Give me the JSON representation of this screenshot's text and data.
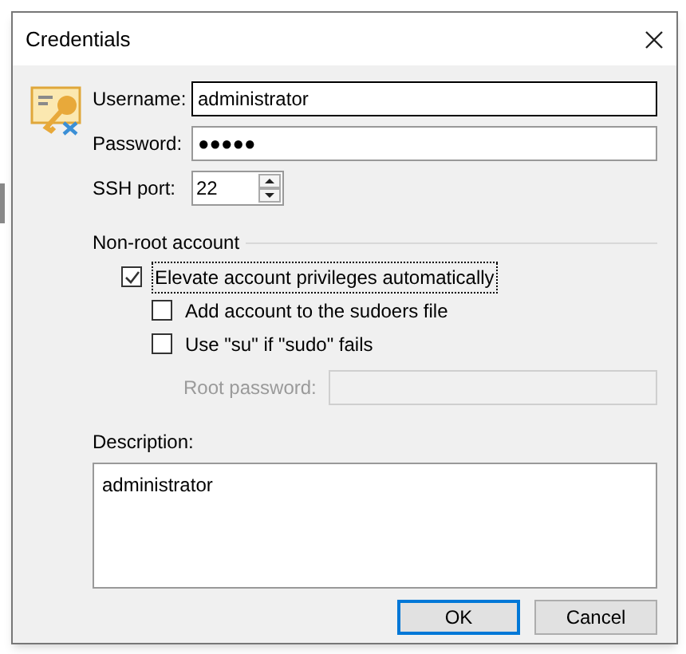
{
  "window": {
    "title": "Credentials"
  },
  "fields": [
    {
      "label": "Username:",
      "value": "administrator",
      "kind": "text",
      "focused": true
    },
    {
      "label": "Password:",
      "value": "●●●●●",
      "kind": "text",
      "focused": false
    },
    {
      "label": "SSH port:",
      "value": "22",
      "kind": "spin",
      "focused": false
    }
  ],
  "non_root": {
    "heading": "Non-root account",
    "options": [
      {
        "label": "Elevate account privileges automatically",
        "checked": true,
        "focused": true,
        "children": [
          {
            "label": "Add account to the sudoers file",
            "checked": false,
            "focused": false
          },
          {
            "label": "Use \"su\" if \"sudo\" fails",
            "checked": false,
            "focused": false
          }
        ]
      }
    ],
    "root_password": {
      "label": "Root password:",
      "disabled": true
    }
  },
  "description": {
    "label": "Description:",
    "value": "administrator"
  },
  "buttons": [
    {
      "label": "OK",
      "default": true
    },
    {
      "label": "Cancel",
      "default": false
    }
  ]
}
